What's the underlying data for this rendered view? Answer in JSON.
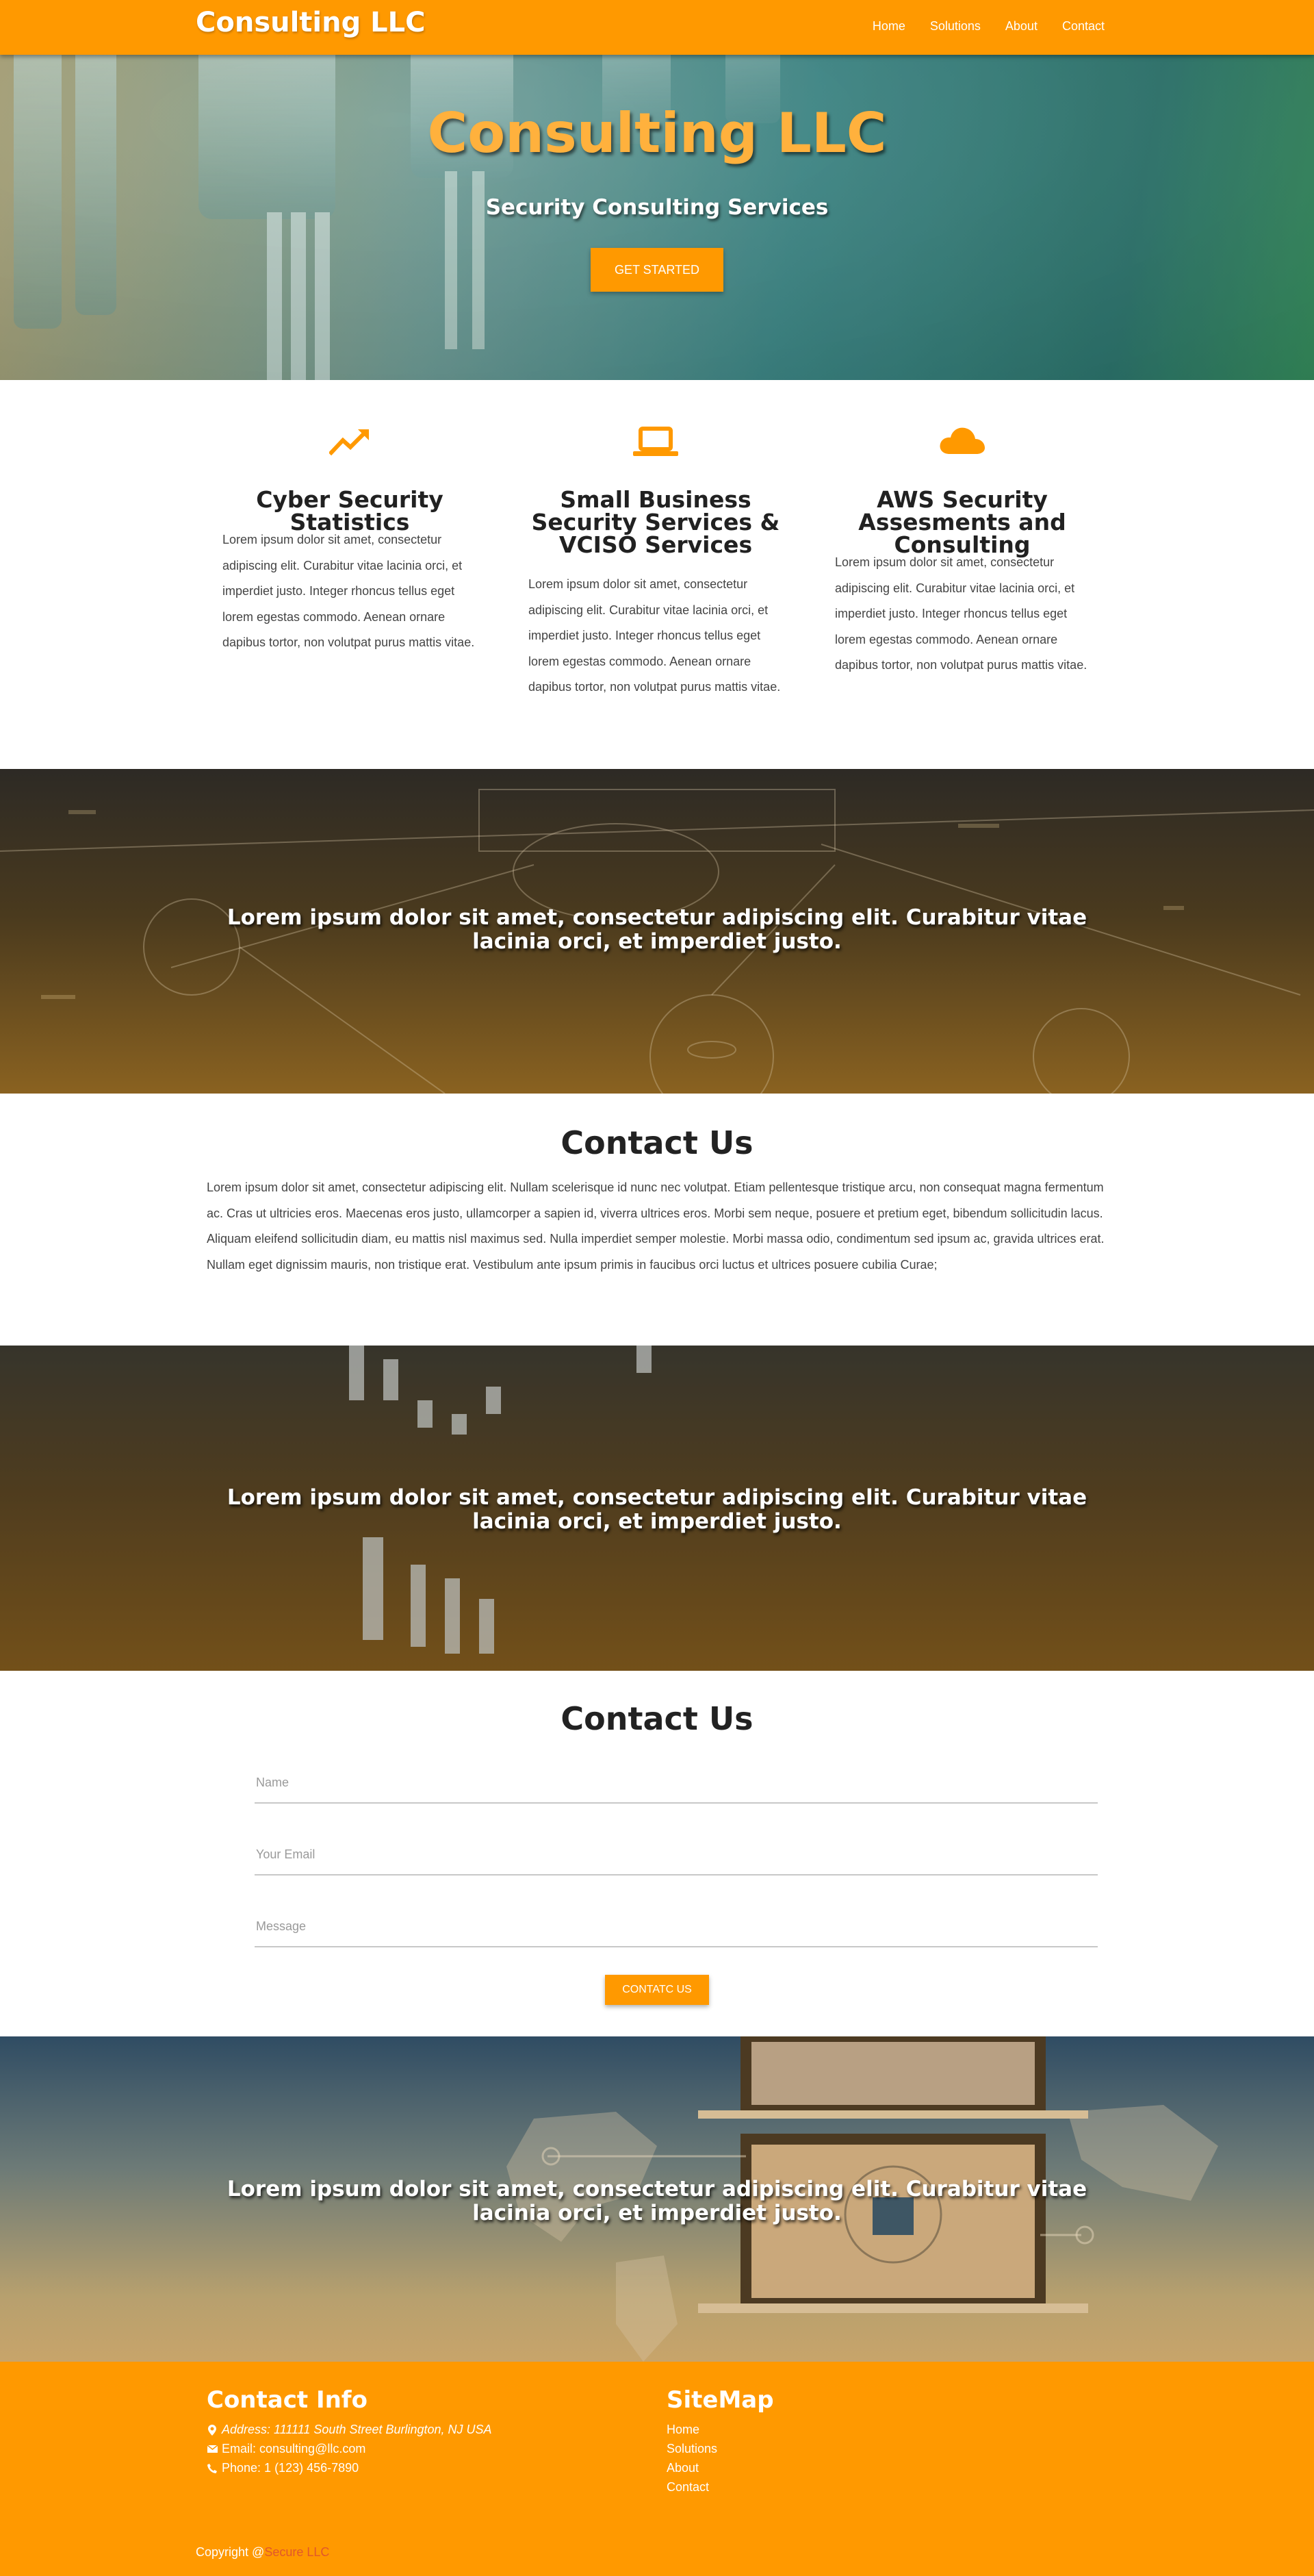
{
  "nav": {
    "brand": "Consulting LLC",
    "links": [
      "Home",
      "Solutions",
      "About",
      "Contact"
    ]
  },
  "hero": {
    "title": "Consulting LLC",
    "subtitle": "Security Consulting Services",
    "cta": "GET STARTED"
  },
  "features": [
    {
      "icon": "trending-up-icon",
      "title": "Cyber Security Statistics",
      "text": "Lorem ipsum dolor sit amet, consectetur adipiscing elit. Curabitur vitae lacinia orci, et imperdiet justo. Integer rhoncus tellus eget lorem egestas commodo. Aenean ornare dapibus tortor, non volutpat purus mattis vitae."
    },
    {
      "icon": "laptop-icon",
      "title": "Small Business Security Services & VCISO Services",
      "text": "Lorem ipsum dolor sit amet, consectetur adipiscing elit. Curabitur vitae lacinia orci, et imperdiet justo. Integer rhoncus tellus eget lorem egestas commodo. Aenean ornare dapibus tortor, non volutpat purus mattis vitae."
    },
    {
      "icon": "cloud-icon",
      "title": "AWS Security Assesments and Consulting",
      "text": "Lorem ipsum dolor sit amet, consectetur adipiscing elit. Curabitur vitae lacinia orci, et imperdiet justo. Integer rhoncus tellus eget lorem egestas commodo. Aenean ornare dapibus tortor, non volutpat purus mattis vitae."
    }
  ],
  "banners": [
    "Lorem ipsum dolor sit amet, consectetur adipiscing elit. Curabitur vitae lacinia orci, et imperdiet justo.",
    "Lorem ipsum dolor sit amet, consectetur adipiscing elit. Curabitur vitae lacinia orci, et imperdiet justo.",
    "Lorem ipsum dolor sit amet, consectetur adipiscing elit. Curabitur vitae lacinia orci, et imperdiet justo."
  ],
  "about": {
    "title": "Contact Us",
    "text": "Lorem ipsum dolor sit amet, consectetur adipiscing elit. Nullam scelerisque id nunc nec volutpat. Etiam pellentesque tristique arcu, non consequat magna fermentum ac. Cras ut ultricies eros. Maecenas eros justo, ullamcorper a sapien id, viverra ultrices eros. Morbi sem neque, posuere et pretium eget, bibendum sollicitudin lacus. Aliquam eleifend sollicitudin diam, eu mattis nisl maximus sed. Nulla imperdiet semper molestie. Morbi massa odio, condimentum sed ipsum ac, gravida ultrices erat. Nullam eget dignissim mauris, non tristique erat. Vestibulum ante ipsum primis in faucibus orci luctus et ultrices posuere cubilia Curae;"
  },
  "contact_form": {
    "title": "Contact Us",
    "name_placeholder": "Name",
    "email_placeholder": "Your Email",
    "message_placeholder": "Message",
    "submit": "CONTATC US"
  },
  "footer": {
    "contact_title": "Contact Info",
    "address": "Address: 111111 South Street Burlington, NJ USA",
    "email": "Email: consulting@llc.com",
    "phone": "Phone: 1 (123) 456-7890",
    "sitemap_title": "SiteMap",
    "sitemap": [
      "Home",
      "Solutions",
      "About",
      "Contact"
    ],
    "copyright_prefix": "Copyright @",
    "copyright_link": "Secure LLC"
  },
  "colors": {
    "accent": "#ff9900",
    "hero_title": "#ffb13d",
    "copyright_link": "#e2572b"
  }
}
